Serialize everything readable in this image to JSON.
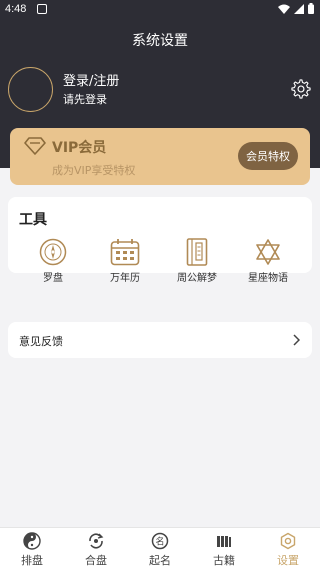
{
  "status_bar": {
    "time": "4:48"
  },
  "header": {
    "title": "系统设置"
  },
  "user": {
    "login_label": "登录/注册",
    "login_sub": "请先登录"
  },
  "vip": {
    "title": "VIP会员",
    "subtitle": "成为VIP享受特权",
    "button_label": "会员特权"
  },
  "tools": {
    "title": "工具",
    "items": [
      {
        "label": "罗盘",
        "icon": "compass-icon"
      },
      {
        "label": "万年历",
        "icon": "calendar-icon"
      },
      {
        "label": "周公解梦",
        "icon": "book-icon"
      },
      {
        "label": "星座物语",
        "icon": "star-of-david-icon"
      }
    ]
  },
  "feedback": {
    "label": "意见反馈"
  },
  "tab_bar": {
    "items": [
      {
        "label": "排盘",
        "icon": "yin-yang-icon"
      },
      {
        "label": "合盘",
        "icon": "merge-icon"
      },
      {
        "label": "起名",
        "icon": "naming-icon"
      },
      {
        "label": "古籍",
        "icon": "ancient-books-icon"
      },
      {
        "label": "设置",
        "icon": "settings-icon"
      }
    ],
    "active_index": 4
  },
  "colors": {
    "header_bg": "#2d2d35",
    "gold": "#c8a56a",
    "vip_bg": "#e9c48e",
    "vip_button": "#7f6342"
  }
}
